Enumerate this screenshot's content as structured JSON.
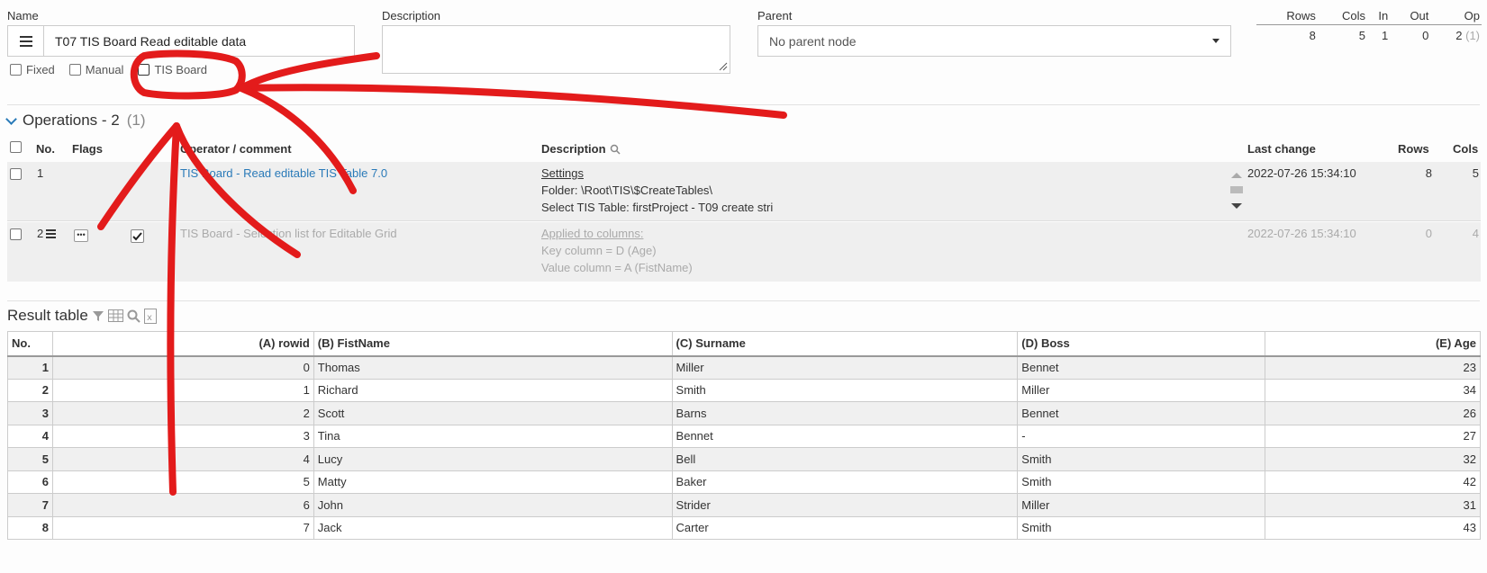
{
  "header": {
    "name_label": "Name",
    "name_value": "T07 TIS Board Read editable data",
    "description_label": "Description",
    "description_value": "",
    "parent_label": "Parent",
    "parent_value": "No parent node",
    "checkboxes": [
      {
        "label": "Fixed",
        "checked": false
      },
      {
        "label": "Manual",
        "checked": false
      },
      {
        "label": "TIS Board",
        "checked": false
      }
    ]
  },
  "stats": {
    "headers": [
      "Rows",
      "Cols",
      "In",
      "Out",
      "Op"
    ],
    "rows": "8",
    "cols": "5",
    "in": "1",
    "out": "0",
    "op": "2",
    "op_extra": "(1)"
  },
  "operations": {
    "title": "Operations - 2",
    "count_extra": "(1)",
    "columns": {
      "no": "No.",
      "flags": "Flags",
      "operator": "Operator / comment",
      "description": "Description",
      "last_change": "Last change",
      "rows": "Rows",
      "cols": "Cols"
    },
    "items": [
      {
        "no": "1",
        "operator": "TIS Board - Read editable TIS Table 7.0",
        "desc_title": "Settings",
        "desc_lines": [
          "Folder: \\Root\\TIS\\$CreateTables\\",
          "Select TIS Table: firstProject - T09 create stri"
        ],
        "last_change": "2022-07-26 15:34:10",
        "rows": "8",
        "cols": "5"
      },
      {
        "no": "2",
        "operator": "TIS Board - Selection list for Editable Grid",
        "desc_title": "Applied to columns:",
        "desc_lines": [
          "Key column = D (Age)",
          "Value column = A (FistName)"
        ],
        "last_change": "2022-07-26 15:34:10",
        "rows": "0",
        "cols": "4"
      }
    ]
  },
  "result": {
    "title": "Result table",
    "columns": [
      "No.",
      "(A) rowid",
      "(B) FistName",
      "(C) Surname",
      "(D) Boss",
      "(E) Age"
    ],
    "rows": [
      [
        "1",
        "0",
        "Thomas",
        "Miller",
        "Bennet",
        "23"
      ],
      [
        "2",
        "1",
        "Richard",
        "Smith",
        "Miller",
        "34"
      ],
      [
        "3",
        "2",
        "Scott",
        "Barns",
        "Bennet",
        "26"
      ],
      [
        "4",
        "3",
        "Tina",
        "Bennet",
        "-",
        "27"
      ],
      [
        "5",
        "4",
        "Lucy",
        "Bell",
        "Smith",
        "32"
      ],
      [
        "6",
        "5",
        "Matty",
        "Baker",
        "Smith",
        "42"
      ],
      [
        "7",
        "6",
        "John",
        "Strider",
        "Miller",
        "31"
      ],
      [
        "8",
        "7",
        "Jack",
        "Carter",
        "Smith",
        "43"
      ]
    ]
  },
  "colors": {
    "link": "#2a7ab8",
    "annotation": "#e31b1b"
  },
  "icons": [
    "menu-lines-icon",
    "chevron-down-icon",
    "zoom-icon",
    "filter-icon",
    "grid-icon",
    "excel-icon",
    "resize-grip-icon"
  ]
}
